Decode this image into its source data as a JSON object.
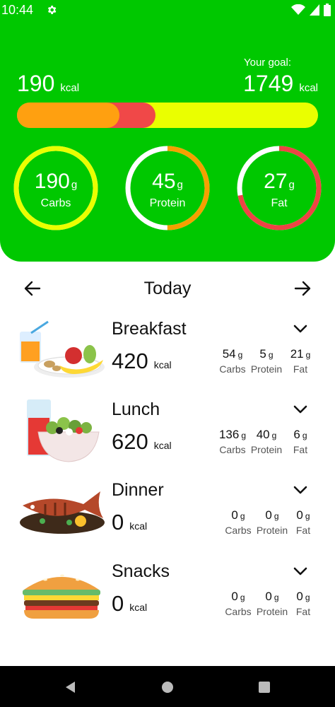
{
  "status_bar": {
    "time": "10:44"
  },
  "summary": {
    "consumed": "190",
    "consumed_unit": "kcal",
    "goal_label": "Your goal:",
    "goal": "1749",
    "goal_unit": "kcal",
    "bar_fraction_orange": 0.34,
    "bar_fraction_red": 0.46
  },
  "rings": [
    {
      "value": "190",
      "unit": "g",
      "label": "Carbs",
      "fraction": 1.0,
      "color": "#eaff00"
    },
    {
      "value": "45",
      "unit": "g",
      "label": "Protein",
      "fraction": 0.5,
      "color": "#f5a000"
    },
    {
      "value": "27",
      "unit": "g",
      "label": "Fat",
      "fraction": 0.72,
      "color": "#ee4444"
    }
  ],
  "colors": {
    "header_green": "#00c800",
    "bar_yellow": "#eaff00",
    "bar_orange": "#ffa010",
    "bar_red": "#f04848"
  },
  "date_nav": {
    "title": "Today",
    "prev_icon": "arrow-left-icon",
    "next_icon": "arrow-right-icon"
  },
  "meals": [
    {
      "name": "Breakfast",
      "kcal": "420",
      "kcal_unit": "kcal",
      "icon": "breakfast-icon",
      "macros": [
        {
          "value": "54",
          "unit": "g",
          "label": "Carbs"
        },
        {
          "value": "5",
          "unit": "g",
          "label": "Protein"
        },
        {
          "value": "21",
          "unit": "g",
          "label": "Fat"
        }
      ]
    },
    {
      "name": "Lunch",
      "kcal": "620",
      "kcal_unit": "kcal",
      "icon": "salad-icon",
      "macros": [
        {
          "value": "136",
          "unit": "g",
          "label": "Carbs"
        },
        {
          "value": "40",
          "unit": "g",
          "label": "Protein"
        },
        {
          "value": "6",
          "unit": "g",
          "label": "Fat"
        }
      ]
    },
    {
      "name": "Dinner",
      "kcal": "0",
      "kcal_unit": "kcal",
      "icon": "fish-icon",
      "macros": [
        {
          "value": "0",
          "unit": "g",
          "label": "Carbs"
        },
        {
          "value": "0",
          "unit": "g",
          "label": "Protein"
        },
        {
          "value": "0",
          "unit": "g",
          "label": "Fat"
        }
      ]
    },
    {
      "name": "Snacks",
      "kcal": "0",
      "kcal_unit": "kcal",
      "icon": "sandwich-icon",
      "macros": [
        {
          "value": "0",
          "unit": "g",
          "label": "Carbs"
        },
        {
          "value": "0",
          "unit": "g",
          "label": "Protein"
        },
        {
          "value": "0",
          "unit": "g",
          "label": "Fat"
        }
      ]
    }
  ]
}
